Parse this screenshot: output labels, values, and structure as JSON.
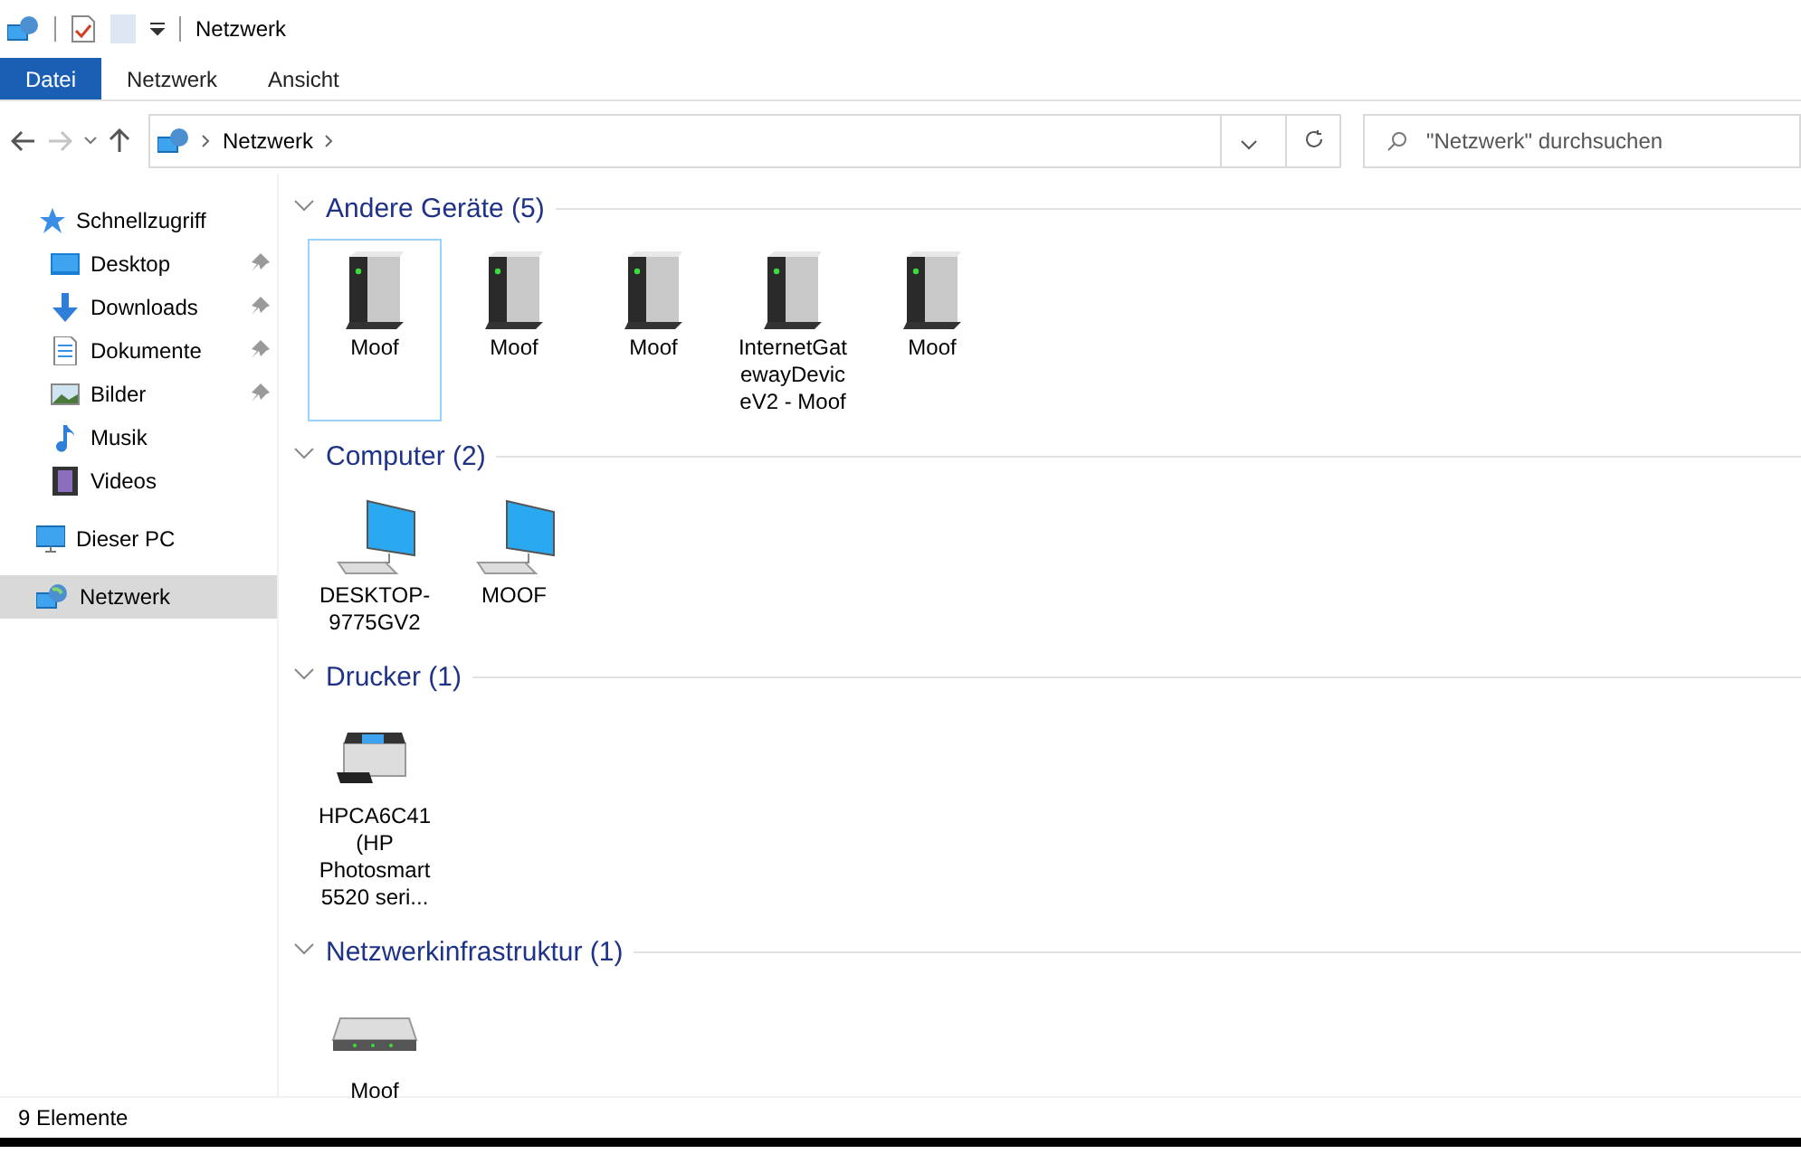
{
  "window": {
    "title": "Netzwerk"
  },
  "ribbon_tabs": [
    {
      "label": "Datei",
      "kind": "file"
    },
    {
      "label": "Netzwerk",
      "kind": "tab"
    },
    {
      "label": "Ansicht",
      "kind": "tab"
    }
  ],
  "address_bar": {
    "crumbs": [
      "Netzwerk"
    ]
  },
  "search": {
    "placeholder": "\"Netzwerk\" durchsuchen"
  },
  "sidebar": {
    "items": [
      {
        "label": "Schnellzugriff",
        "selected": false,
        "children": [
          {
            "label": "Desktop",
            "pinned": true,
            "selected": false
          },
          {
            "label": "Downloads",
            "pinned": true,
            "selected": false
          },
          {
            "label": "Dokumente",
            "pinned": true,
            "selected": false
          },
          {
            "label": "Bilder",
            "pinned": true,
            "selected": false
          },
          {
            "label": "Musik",
            "pinned": false,
            "selected": false
          },
          {
            "label": "Videos",
            "pinned": false,
            "selected": false
          }
        ]
      },
      {
        "label": "Dieser PC",
        "selected": false
      },
      {
        "label": "Netzwerk",
        "selected": true
      }
    ]
  },
  "groups": [
    {
      "title": "Andere Geräte (5)",
      "expanded": true,
      "items": [
        {
          "label": "Moof",
          "kind": "device",
          "selected": true
        },
        {
          "label": "Moof",
          "kind": "device",
          "selected": false
        },
        {
          "label": "Moof",
          "kind": "device",
          "selected": false
        },
        {
          "label": "InternetGatewayDeviceV2 - Moof",
          "kind": "device",
          "selected": false
        },
        {
          "label": "Moof",
          "kind": "device",
          "selected": false
        }
      ]
    },
    {
      "title": "Computer (2)",
      "expanded": true,
      "items": [
        {
          "label": "DESKTOP-9775GV2",
          "kind": "computer",
          "selected": false
        },
        {
          "label": "MOOF",
          "kind": "computer",
          "selected": false
        }
      ]
    },
    {
      "title": "Drucker (1)",
      "expanded": true,
      "items": [
        {
          "label": "HPCA6C41 (HP Photosmart 5520 seri...",
          "kind": "printer",
          "selected": false
        }
      ]
    },
    {
      "title": "Netzwerkinfrastruktur (1)",
      "expanded": true,
      "items": [
        {
          "label": "Moof",
          "kind": "router",
          "selected": false
        }
      ]
    }
  ],
  "status_bar": {
    "text": "9 Elemente"
  }
}
